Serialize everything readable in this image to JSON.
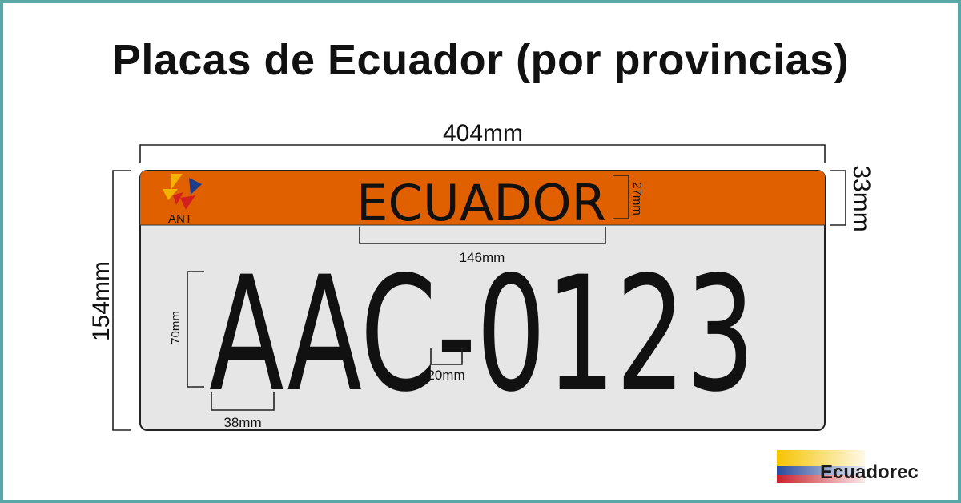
{
  "title": "Placas de Ecuador (por provincias)",
  "plate": {
    "header_text": "ECUADOR",
    "agency": "ANT",
    "number": "AAC-0123",
    "colors": {
      "header": "#e06000",
      "body": "#e6e6e6",
      "text": "#111111"
    }
  },
  "dimensions": {
    "width": "404mm",
    "height": "154mm",
    "header_height": "33mm",
    "header_text_height": "27mm",
    "header_text_width": "146mm",
    "char_height": "70mm",
    "char_width": "38mm",
    "dash_width": "20mm"
  },
  "brand": {
    "name": "Ecuadorec"
  },
  "icons": {
    "agency_logo": "ant-logo-icon",
    "brand_logo": "ecuador-flag-stripes-icon"
  }
}
